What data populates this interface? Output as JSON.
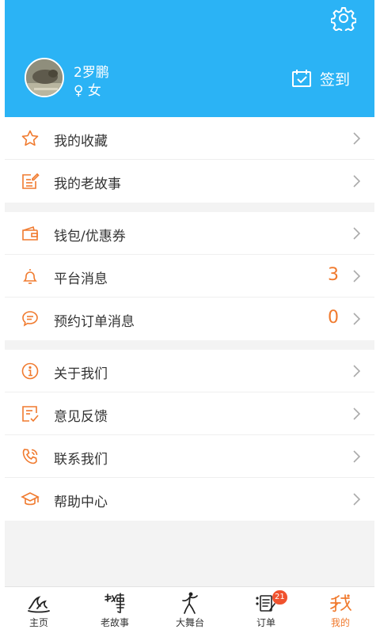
{
  "colors": {
    "header_bg": "#2bb3f5",
    "accent": "#f07a2e",
    "badge": "#f0522e"
  },
  "header": {
    "settings_icon": "gear-icon",
    "user": {
      "name": "2罗鹏",
      "gender": "♀ 女"
    },
    "signin": {
      "label": "签到",
      "icon": "calendar-check-icon"
    }
  },
  "menu": {
    "group1": [
      {
        "label": "我的收藏",
        "icon": "star-icon"
      },
      {
        "label": "我的老故事",
        "icon": "note-edit-icon"
      }
    ],
    "group2": [
      {
        "label": "钱包/优惠券",
        "icon": "wallet-icon"
      },
      {
        "label": "平台消息",
        "icon": "bell-icon",
        "count": "3"
      },
      {
        "label": "预约订单消息",
        "icon": "chat-bubble-icon",
        "count": "0"
      }
    ],
    "group3": [
      {
        "label": "关于我们",
        "icon": "info-icon"
      },
      {
        "label": "意见反馈",
        "icon": "feedback-icon"
      },
      {
        "label": "联系我们",
        "icon": "phone-icon"
      },
      {
        "label": "帮助中心",
        "icon": "graduation-cap-icon"
      }
    ]
  },
  "tabbar": {
    "tabs": [
      {
        "label": "主页",
        "icon": "home-waves-icon"
      },
      {
        "label": "老故事",
        "icon": "story-calligraphy-icon"
      },
      {
        "label": "大舞台",
        "icon": "dancer-icon"
      },
      {
        "label": "订单",
        "icon": "order-list-icon",
        "badge": "21"
      },
      {
        "label": "我的",
        "icon": "me-calligraphy-icon",
        "active": true
      }
    ]
  }
}
